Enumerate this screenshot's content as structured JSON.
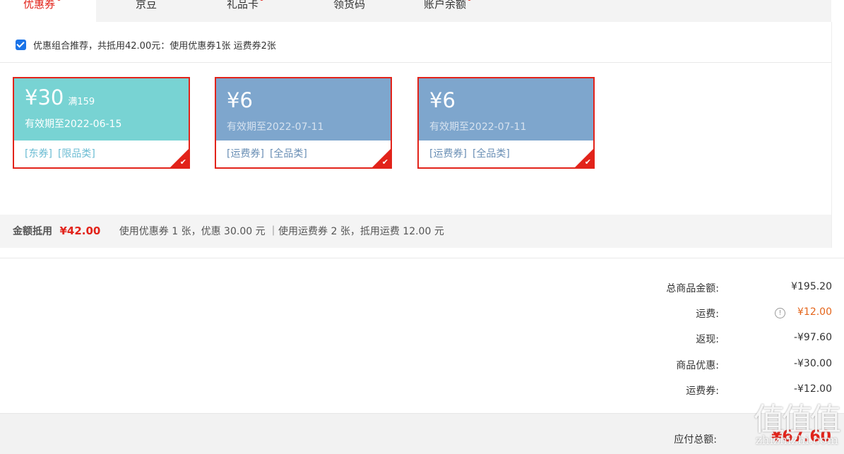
{
  "tabs": [
    {
      "label": "优惠券",
      "dot": true,
      "active": true
    },
    {
      "label": "京豆",
      "dot": false,
      "active": false
    },
    {
      "label": "礼品卡",
      "dot": true,
      "active": false
    },
    {
      "label": "领货码",
      "dot": false,
      "active": false
    },
    {
      "label": "账户余额",
      "dot": true,
      "active": false
    }
  ],
  "combo_text": "优惠组合推荐，共抵用42.00元：使用优惠券1张 运费券2张",
  "coupons": [
    {
      "amount": "¥30",
      "condition": "满159",
      "expiry": "有效期至2022-06-15",
      "tags": [
        "[东券]",
        "[限品类]"
      ],
      "color": "#78d3d3",
      "tag_color": "#6bbcd3"
    },
    {
      "amount": "¥6",
      "condition": "",
      "expiry": "有效期至2022-07-11",
      "tags": [
        "[运费券]",
        "[全品类]"
      ],
      "color": "#7ea6cd",
      "tag_color": "#6a8fb5"
    },
    {
      "amount": "¥6",
      "condition": "",
      "expiry": "有效期至2022-07-11",
      "tags": [
        "[运费券]",
        "[全品类]"
      ],
      "color": "#7ea6cd",
      "tag_color": "#6a8fb5"
    }
  ],
  "summary": {
    "label": "金额抵用",
    "amount": "¥42.00",
    "detail": "使用优惠券 1 张，优惠 30.00 元 ｜使用运费券 2 张，抵用运费 12.00 元"
  },
  "totals": [
    {
      "label": "总商品金额:",
      "value": "¥195.20",
      "color": "#333333"
    },
    {
      "label": "运费:",
      "value": "¥12.00",
      "color": "#e4651b",
      "info": "!"
    },
    {
      "label": "返现:",
      "value": "-¥97.60",
      "color": "#333333"
    },
    {
      "label": "商品优惠:",
      "value": "-¥30.00",
      "color": "#333333"
    },
    {
      "label": "运费券:",
      "value": "-¥12.00",
      "color": "#333333"
    }
  ],
  "payable": {
    "label": "应付总额:",
    "value": "¥67.60"
  },
  "watermark": {
    "chars": "值值值",
    "url": "zhizhizhi.com"
  }
}
